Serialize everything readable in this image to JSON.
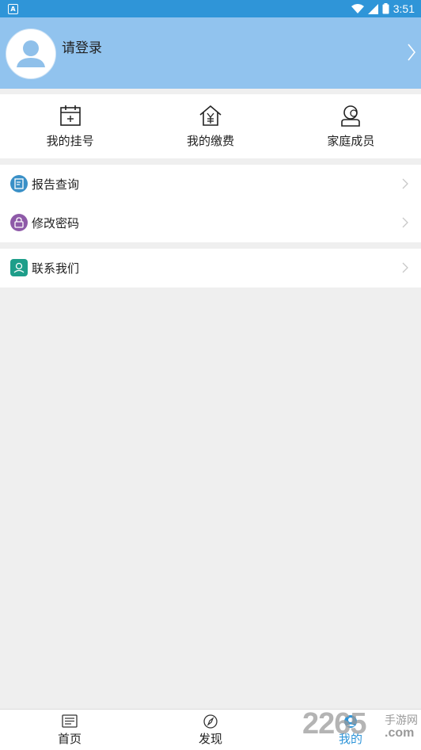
{
  "status_bar": {
    "time": "3:51"
  },
  "header": {
    "login_prompt": "请登录"
  },
  "quick_actions": [
    {
      "label": "我的挂号",
      "icon": "calendar-add-icon"
    },
    {
      "label": "我的缴费",
      "icon": "house-yen-icon"
    },
    {
      "label": "家庭成员",
      "icon": "family-member-icon"
    }
  ],
  "menu": {
    "group1": [
      {
        "label": "报告查询",
        "icon": "report-icon",
        "color": "#3a90c7"
      },
      {
        "label": "修改密码",
        "icon": "lock-icon",
        "color": "#8e5aa8"
      }
    ],
    "group2": [
      {
        "label": "联系我们",
        "icon": "contact-icon",
        "color": "#1e9e8a"
      }
    ]
  },
  "tabs": [
    {
      "label": "首页",
      "icon": "home-news-icon"
    },
    {
      "label": "发现",
      "icon": "compass-icon"
    },
    {
      "label": "我的",
      "icon": "profile-icon",
      "active": true
    }
  ],
  "watermark": {
    "number": "2265",
    "cn": "手游网",
    "com": ".com"
  },
  "colors": {
    "accent": "#2f95d8",
    "header_bg": "#91c3ee"
  }
}
